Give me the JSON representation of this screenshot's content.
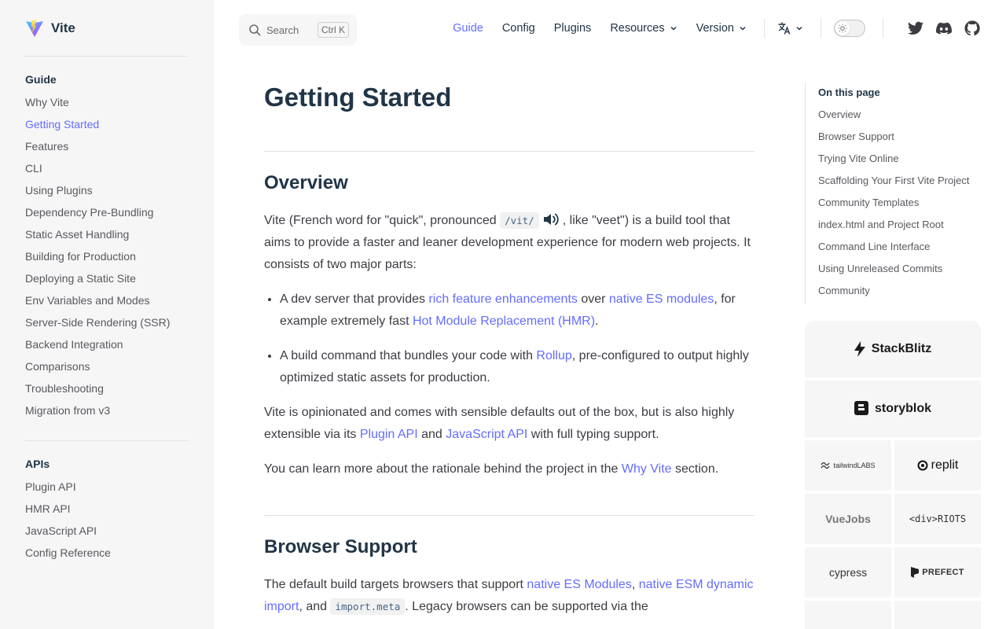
{
  "brand": {
    "name": "Vite"
  },
  "search": {
    "placeholder": "Search",
    "shortcut": "Ctrl K"
  },
  "nav": {
    "links": [
      "Guide",
      "Config",
      "Plugins"
    ],
    "resources": "Resources",
    "version": "Version",
    "active_color": "#646cff"
  },
  "sidebar": {
    "groups": [
      {
        "title": "Guide",
        "items": [
          "Why Vite",
          "Getting Started",
          "Features",
          "CLI",
          "Using Plugins",
          "Dependency Pre-Bundling",
          "Static Asset Handling",
          "Building for Production",
          "Deploying a Static Site",
          "Env Variables and Modes",
          "Server-Side Rendering (SSR)",
          "Backend Integration",
          "Comparisons",
          "Troubleshooting",
          "Migration from v3"
        ]
      },
      {
        "title": "APIs",
        "items": [
          "Plugin API",
          "HMR API",
          "JavaScript API",
          "Config Reference"
        ]
      }
    ]
  },
  "page": {
    "title": "Getting Started",
    "overview": {
      "heading": "Overview",
      "p1_a": "Vite (French word for \"quick\", pronounced ",
      "p1_code": "/vit/",
      "p1_b": ", like \"veet\") is a build tool that aims to provide a faster and leaner development experience for modern web projects. It consists of two major parts:",
      "b1_a": "A dev server that provides ",
      "b1_l1": "rich feature enhancements",
      "b1_b": " over ",
      "b1_l2": "native ES modules",
      "b1_c": ", for example extremely fast ",
      "b1_l3": "Hot Module Replacement (HMR)",
      "b1_d": ".",
      "b2_a": "A build command that bundles your code with ",
      "b2_l1": "Rollup",
      "b2_b": ", pre-configured to output highly optimized static assets for production.",
      "p2_a": "Vite is opinionated and comes with sensible defaults out of the box, but is also highly extensible via its ",
      "p2_l1": "Plugin API",
      "p2_b": " and ",
      "p2_l2": "JavaScript API",
      "p2_c": " with full typing support.",
      "p3_a": "You can learn more about the rationale behind the project in the ",
      "p3_l1": "Why Vite",
      "p3_b": " section."
    },
    "browser": {
      "heading": "Browser Support",
      "p1_a": "The default build targets browsers that support ",
      "p1_l1": "native ES Modules",
      "p1_sep": ", ",
      "p1_l2": "native ESM dynamic import",
      "p1_b": ", and ",
      "p1_code": "import.meta",
      "p1_c": ". Legacy browsers can be supported via the"
    }
  },
  "toc": {
    "title": "On this page",
    "items": [
      "Overview",
      "Browser Support",
      "Trying Vite Online",
      "Scaffolding Your First Vite Project",
      "Community Templates",
      "index.html and Project Root",
      "Command Line Interface",
      "Using Unreleased Commits",
      "Community"
    ]
  },
  "sponsors": {
    "big": [
      "StackBlitz",
      "storyblok"
    ],
    "small": [
      "tailwindLABS",
      "replit",
      "VueJobs",
      "<div>RIOTS",
      "cypress",
      "PREFECT"
    ]
  }
}
